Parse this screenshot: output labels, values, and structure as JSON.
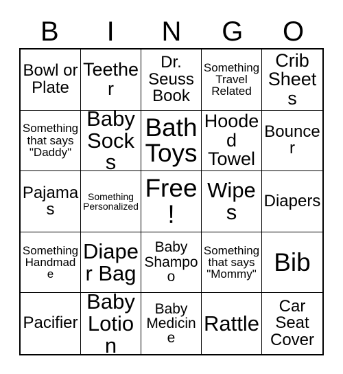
{
  "header": {
    "letters": [
      "B",
      "I",
      "N",
      "G",
      "O"
    ]
  },
  "grid": {
    "rows": [
      [
        {
          "text": "Bowl or Plate",
          "size": "md"
        },
        {
          "text": "Teether",
          "size": "lg"
        },
        {
          "text": "Dr. Seuss Book",
          "size": "md"
        },
        {
          "text": "Something Travel Related",
          "size": "xs"
        },
        {
          "text": "Crib Sheets",
          "size": "lg"
        }
      ],
      [
        {
          "text": "Something that says \"Daddy\"",
          "size": "xs"
        },
        {
          "text": "Baby Socks",
          "size": "xl"
        },
        {
          "text": "Bath Toys",
          "size": "xxl"
        },
        {
          "text": "Hooded Towel",
          "size": "lg"
        },
        {
          "text": "Bouncer",
          "size": "md"
        }
      ],
      [
        {
          "text": "Pajamas",
          "size": "md"
        },
        {
          "text": "Something Personalized",
          "size": "xxs"
        },
        {
          "text": "Free!",
          "size": "xxl"
        },
        {
          "text": "Wipes",
          "size": "xl"
        },
        {
          "text": "Diapers",
          "size": "md"
        }
      ],
      [
        {
          "text": "Something Handmade",
          "size": "xs"
        },
        {
          "text": "Diaper Bag",
          "size": "xl"
        },
        {
          "text": "Baby Shampoo",
          "size": "sm"
        },
        {
          "text": "Something that says \"Mommy\"",
          "size": "xs"
        },
        {
          "text": "Bib",
          "size": "xxl"
        }
      ],
      [
        {
          "text": "Pacifier",
          "size": "md"
        },
        {
          "text": "Baby Lotion",
          "size": "xl"
        },
        {
          "text": "Baby Medicine",
          "size": "sm"
        },
        {
          "text": "Rattle",
          "size": "xl"
        },
        {
          "text": "Car Seat Cover",
          "size": "md"
        }
      ]
    ]
  },
  "colors": {
    "text": "#000000",
    "background": "#ffffff",
    "border": "#000000"
  }
}
